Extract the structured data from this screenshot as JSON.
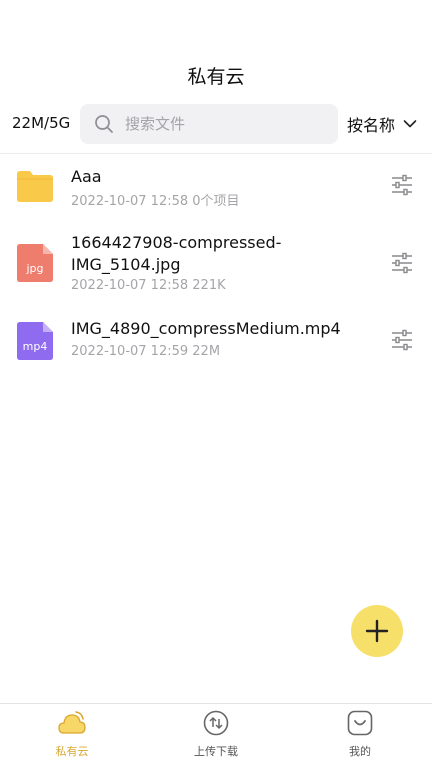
{
  "header": {
    "title": "私有云"
  },
  "toolbar": {
    "storage": "22M/5G",
    "search_placeholder": "搜索文件",
    "sort_label": "按名称"
  },
  "files": [
    {
      "name": "Aaa",
      "meta": "2022-10-07 12:58 0个项目",
      "icon": "folder-icon"
    },
    {
      "name": "1664427908-compressed-IMG_5104.jpg",
      "meta": "2022-10-07 12:58 221K",
      "icon": "jpg-file-icon",
      "badge": "jpg"
    },
    {
      "name": "IMG_4890_compressMedium.mp4",
      "meta": "2022-10-07 12:59 22M",
      "icon": "mp4-file-icon",
      "badge": "mp4"
    }
  ],
  "tabs": [
    {
      "label": "私有云",
      "active": true
    },
    {
      "label": "上传下载",
      "active": false
    },
    {
      "label": "我的",
      "active": false
    }
  ],
  "colors": {
    "accent": "#d9a731",
    "fab": "#f7e06a",
    "folder": "#f9c94a",
    "jpg": "#ee7d6e",
    "mp4": "#8f6bf0"
  }
}
